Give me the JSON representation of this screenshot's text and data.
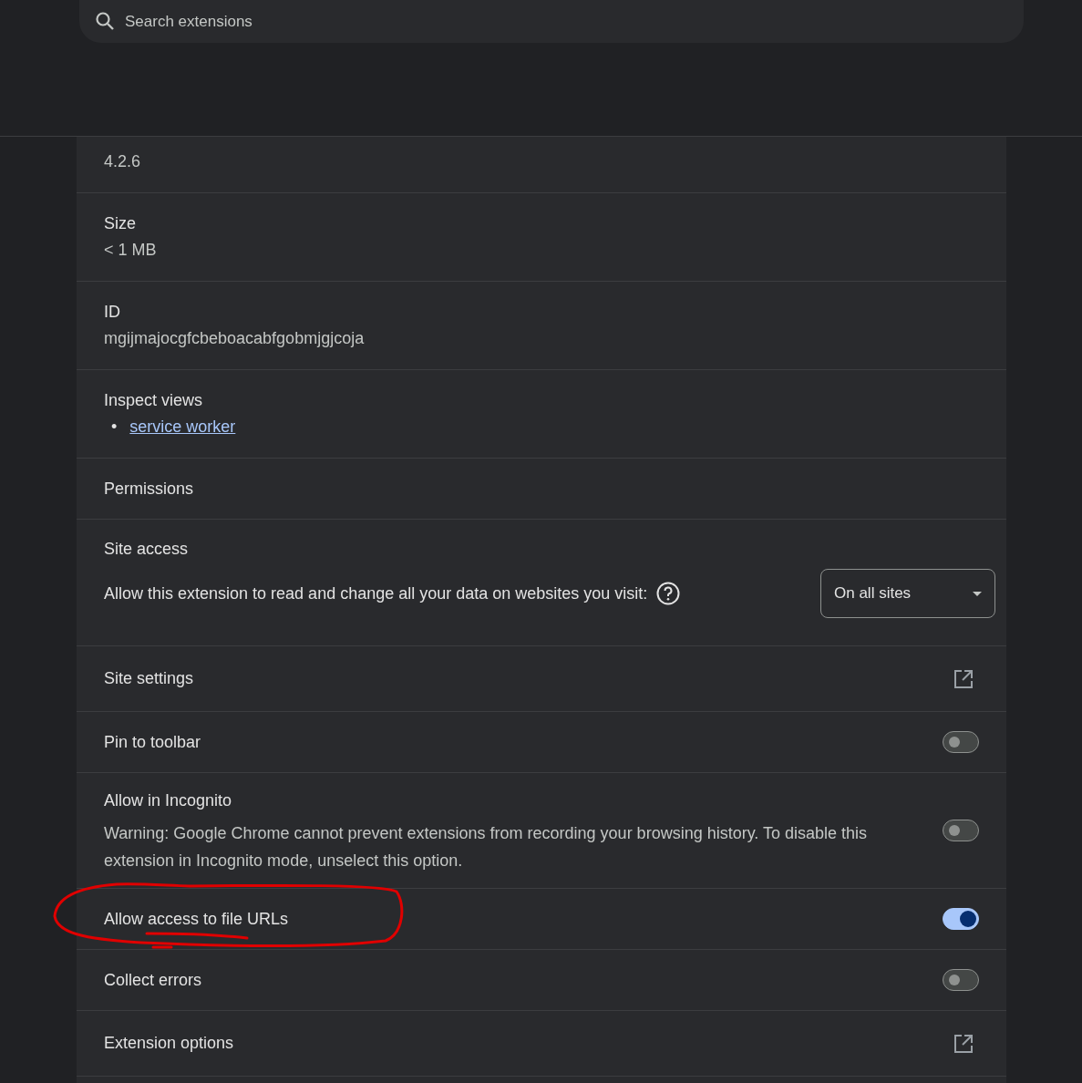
{
  "search": {
    "placeholder": "Search extensions"
  },
  "sections": [
    {
      "kind": "info",
      "value": "4.2.6",
      "circled": false
    },
    {
      "kind": "info",
      "label": "Size",
      "value": "< 1 MB",
      "circled": false
    },
    {
      "kind": "info",
      "label": "ID",
      "value": "mgijmajocgfcbeboacabfgobmjgjcoja",
      "circled": false
    },
    {
      "kind": "links",
      "label": "Inspect views",
      "bullet": "•",
      "links": [
        "service worker"
      ],
      "circled": false
    },
    {
      "kind": "heading",
      "label": "Permissions",
      "circled": false
    },
    {
      "kind": "select",
      "label": "Site access",
      "text": "Allow this extension to read and change all your data on websites you visit:",
      "value": "On all sites",
      "circled": false
    },
    {
      "kind": "external",
      "label": "Site settings",
      "circled": false
    },
    {
      "kind": "toggle",
      "label": "Pin to toolbar",
      "on": false,
      "circled": false
    },
    {
      "kind": "toggle",
      "label": "Allow in Incognito",
      "description": "Warning: Google Chrome cannot prevent extensions from recording your browsing history. To disable this extension in Incognito mode, unselect this option.",
      "on": false,
      "circled": false
    },
    {
      "kind": "toggle",
      "label": "Allow access to file URLs",
      "on": true,
      "circled": true
    },
    {
      "kind": "toggle",
      "label": "Collect errors",
      "on": false,
      "circled": false
    },
    {
      "kind": "external",
      "label": "Extension options",
      "circled": false
    }
  ]
}
